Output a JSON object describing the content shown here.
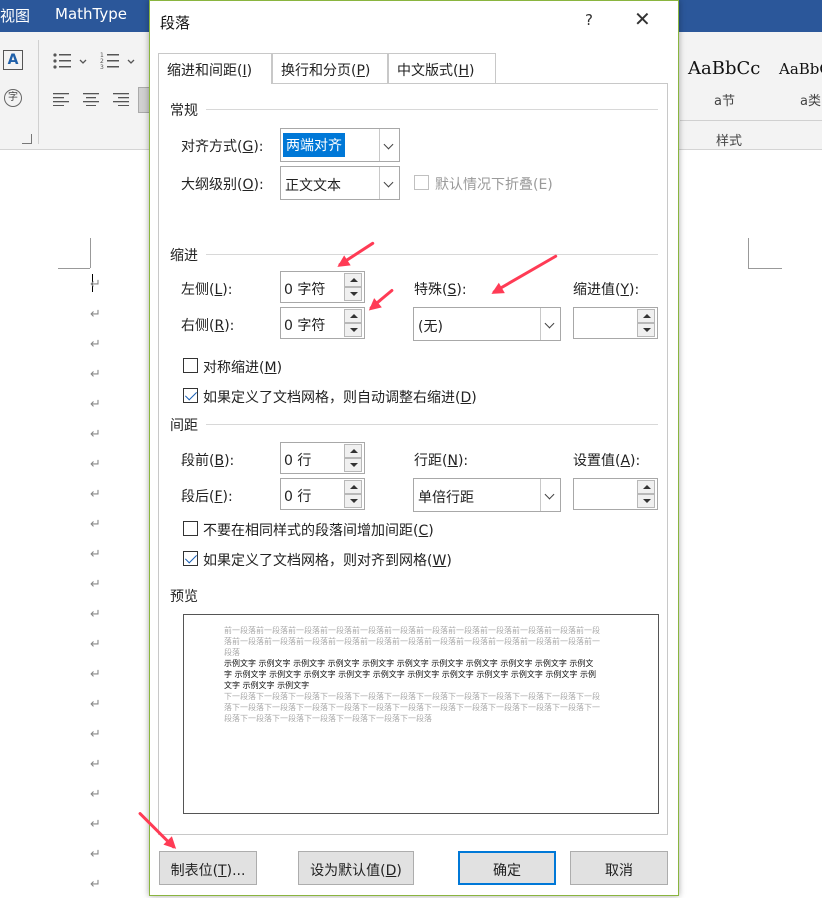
{
  "word": {
    "menu_tabs": [
      "视图",
      "MathType"
    ],
    "ribbon": {
      "styles": [
        {
          "sample": "AaBbCc",
          "name": "a节"
        },
        {
          "sample": "AaBbC",
          "name": "a类"
        }
      ],
      "styles_group_label": "样式",
      "phonetic_glyph": "字"
    },
    "paragraph_mark": "↵"
  },
  "dialog": {
    "title": "段落",
    "help": "?",
    "close": "✕",
    "tabs": [
      {
        "label": "缩进和间距(",
        "key": "I",
        "suffix": ")"
      },
      {
        "label": "换行和分页(",
        "key": "P",
        "suffix": ")"
      },
      {
        "label": "中文版式(",
        "key": "H",
        "suffix": ")"
      }
    ],
    "general": {
      "heading": "常规",
      "alignment_label": "对齐方式(",
      "alignment_key": "G",
      "alignment_suffix": "):",
      "alignment_value": "两端对齐",
      "outline_label": "大纲级别(",
      "outline_key": "O",
      "outline_suffix": "):",
      "outline_value": "正文文本",
      "collapse_label": "默认情况下折叠(E)"
    },
    "indent": {
      "heading": "缩进",
      "left_label": "左侧(",
      "left_key": "L",
      "left_suffix": "):",
      "left_value": "0 字符",
      "right_label": "右侧(",
      "right_key": "R",
      "right_suffix": "):",
      "right_value": "0 字符",
      "special_label": "特殊(",
      "special_key": "S",
      "special_suffix": "):",
      "special_value": "(无)",
      "by_label": "缩进值(",
      "by_key": "Y",
      "by_suffix": "):",
      "by_value": "",
      "mirror_label": "对称缩进(",
      "mirror_key": "M",
      "mirror_suffix": ")",
      "auto_adjust_label": "如果定义了文档网格，则自动调整右缩进(",
      "auto_adjust_key": "D",
      "auto_adjust_suffix": ")"
    },
    "spacing": {
      "heading": "间距",
      "before_label": "段前(",
      "before_key": "B",
      "before_suffix": "):",
      "before_value": "0 行",
      "after_label": "段后(",
      "after_key": "F",
      "after_suffix": "):",
      "after_value": "0 行",
      "line_label": "行距(",
      "line_key": "N",
      "line_suffix": "):",
      "line_value": "单倍行距",
      "at_label": "设置值(",
      "at_key": "A",
      "at_suffix": "):",
      "at_value": "",
      "no_space_label": "不要在相同样式的段落间增加间距(",
      "no_space_key": "C",
      "no_space_suffix": ")",
      "snap_grid_label": "如果定义了文档网格，则对齐到网格(",
      "snap_grid_key": "W",
      "snap_grid_suffix": ")"
    },
    "preview": {
      "heading": "预览",
      "prev_text": "前一段落前一段落前一段落前一段落前一段落前一段落前一段落前一段落前一段落前一段落前一段落前一段落前一段落前一段落前一段落前一段落前一段落前一段落前一段落前一段落前一段落前一段落前一段落前一段落",
      "sample_text": "示例文字 示例文字 示例文字 示例文字 示例文字 示例文字 示例文字 示例文字 示例文字 示例文字 示例文字 示例文字 示例文字 示例文字 示例文字 示例文字 示例文字 示例文字 示例文字 示例文字 示例文字 示例文字 示例文字 示例文字",
      "next_text": "下一段落下一段落下一段落下一段落下一段落下一段落下一段落下一段落下一段落下一段落下一段落下一段落下一段落下一段落下一段落下一段落下一段落下一段落下一段落下一段落下一段落下一段落下一段落下一段落下一段落下一段落下一段落下一段落下一段落下一段落"
    },
    "buttons": {
      "tabs_label": "制表位(",
      "tabs_key": "T",
      "tabs_suffix": ")...",
      "default_label": "设为默认值(",
      "default_key": "D",
      "default_suffix": ")",
      "ok": "确定",
      "cancel": "取消"
    },
    "states": {
      "mirror_indent": false,
      "auto_adjust_right_indent": true,
      "no_space_same_style": false,
      "snap_to_grid": true,
      "collapse_by_default": false
    }
  },
  "colors": {
    "menubar": "#2b579a",
    "dialog_border": "#8ab53f",
    "selection": "#0078d7",
    "annotation_arrow": "#ff3b55"
  }
}
